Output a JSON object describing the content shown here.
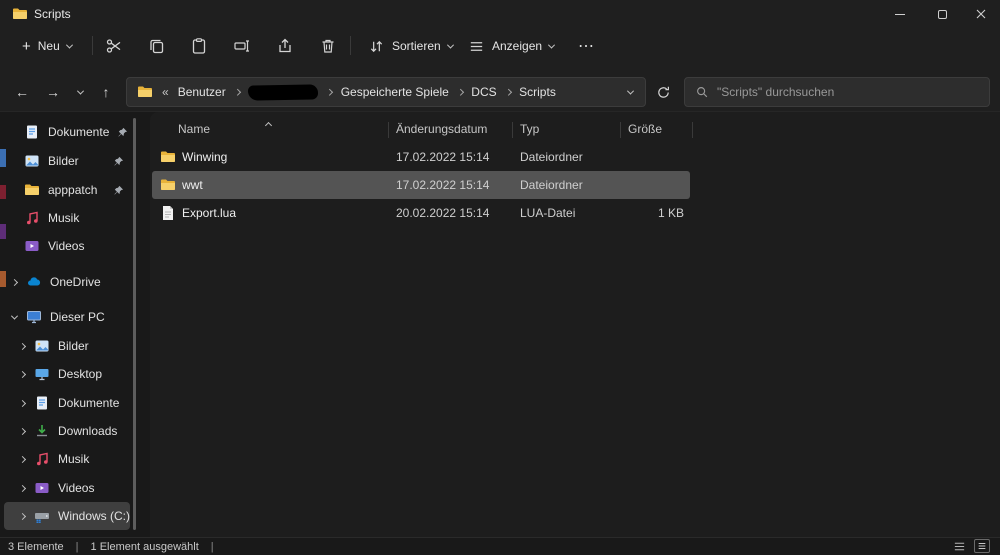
{
  "window": {
    "title": "Scripts"
  },
  "toolbar": {
    "new_plus": "+",
    "new_label": "Neu",
    "sort_label": "Sortieren",
    "view_label": "Anzeigen",
    "more_glyph": "⋯"
  },
  "nav": {
    "back": "←",
    "forward": "→",
    "up": "↑"
  },
  "address": {
    "overflow": "«",
    "crumbs": [
      "Benutzer",
      "",
      "Gespeicherte Spiele",
      "DCS",
      "Scripts"
    ]
  },
  "search": {
    "placeholder": "\"Scripts\" durchsuchen"
  },
  "sidebar": {
    "items": [
      {
        "label": "Dokumente"
      },
      {
        "label": "Bilder"
      },
      {
        "label": "apppatch"
      },
      {
        "label": "Musik"
      },
      {
        "label": "Videos"
      },
      {
        "label": "OneDrive"
      },
      {
        "label": "Dieser PC"
      },
      {
        "label": "Bilder"
      },
      {
        "label": "Desktop"
      },
      {
        "label": "Dokumente"
      },
      {
        "label": "Downloads"
      },
      {
        "label": "Musik"
      },
      {
        "label": "Videos"
      },
      {
        "label": "Windows (C:)"
      }
    ]
  },
  "list": {
    "columns": {
      "name": "Name",
      "date": "Änderungsdatum",
      "type": "Typ",
      "size": "Größe"
    },
    "rows": [
      {
        "name": "Winwing",
        "date": "17.02.2022 15:14",
        "type": "Dateiordner",
        "size": ""
      },
      {
        "name": "wwt",
        "date": "17.02.2022 15:14",
        "type": "Dateiordner",
        "size": ""
      },
      {
        "name": "Export.lua",
        "date": "20.02.2022 15:14",
        "type": "LUA-Datei",
        "size": "1 KB"
      }
    ]
  },
  "status": {
    "items_count": "3 Elemente",
    "selection": "1 Element ausgewählt",
    "separator": "|"
  },
  "colors": {
    "folder_yellow": "#f0c64a",
    "row_selection": "#545454",
    "sidebar_selection": "#3f3f3f"
  }
}
